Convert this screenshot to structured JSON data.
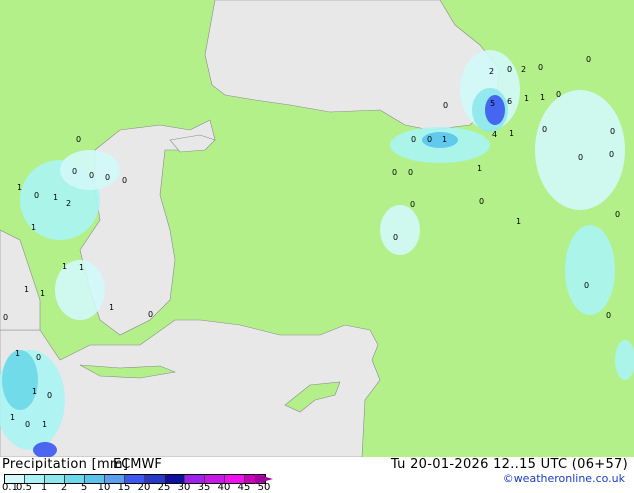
{
  "legend": {
    "title": "Precipitation [mm]",
    "model": "ECMWF",
    "datetime": "Tu 20-01-2026 12..15 UTC (06+57)",
    "credit": "©weatheronline.co.uk",
    "ticks": [
      "0.1",
      "0.5",
      "1",
      "2",
      "5",
      "10",
      "15",
      "20",
      "25",
      "30",
      "35",
      "40",
      "45",
      "50"
    ],
    "colors": [
      "#d2f8f8",
      "#a8f4f4",
      "#8ce8ec",
      "#6cd8e8",
      "#58c4ec",
      "#5aa0ee",
      "#3c58f0",
      "#2838c8",
      "#1010a0",
      "#a020f0",
      "#c818e8",
      "#f010f0",
      "#c800b8"
    ]
  },
  "map": {
    "land_color": "#b4f08a",
    "sea_color": "#e8e8e8",
    "labels": [
      "2",
      "0",
      "2",
      "0",
      "0",
      "0",
      "5",
      "6",
      "1",
      "1",
      "0",
      "0",
      "0",
      "0",
      "1",
      "4",
      "1",
      "0",
      "0",
      "0",
      "0",
      "0",
      "1",
      "0",
      "0",
      "0",
      "0",
      "1",
      "0",
      "0",
      "1",
      "0",
      "2",
      "1",
      "1",
      "0",
      "0",
      "0",
      "0",
      "0",
      "1",
      "1",
      "1",
      "1",
      "1",
      "0",
      "0",
      "0",
      "1",
      "0",
      "1",
      "0",
      "1",
      "1"
    ]
  }
}
